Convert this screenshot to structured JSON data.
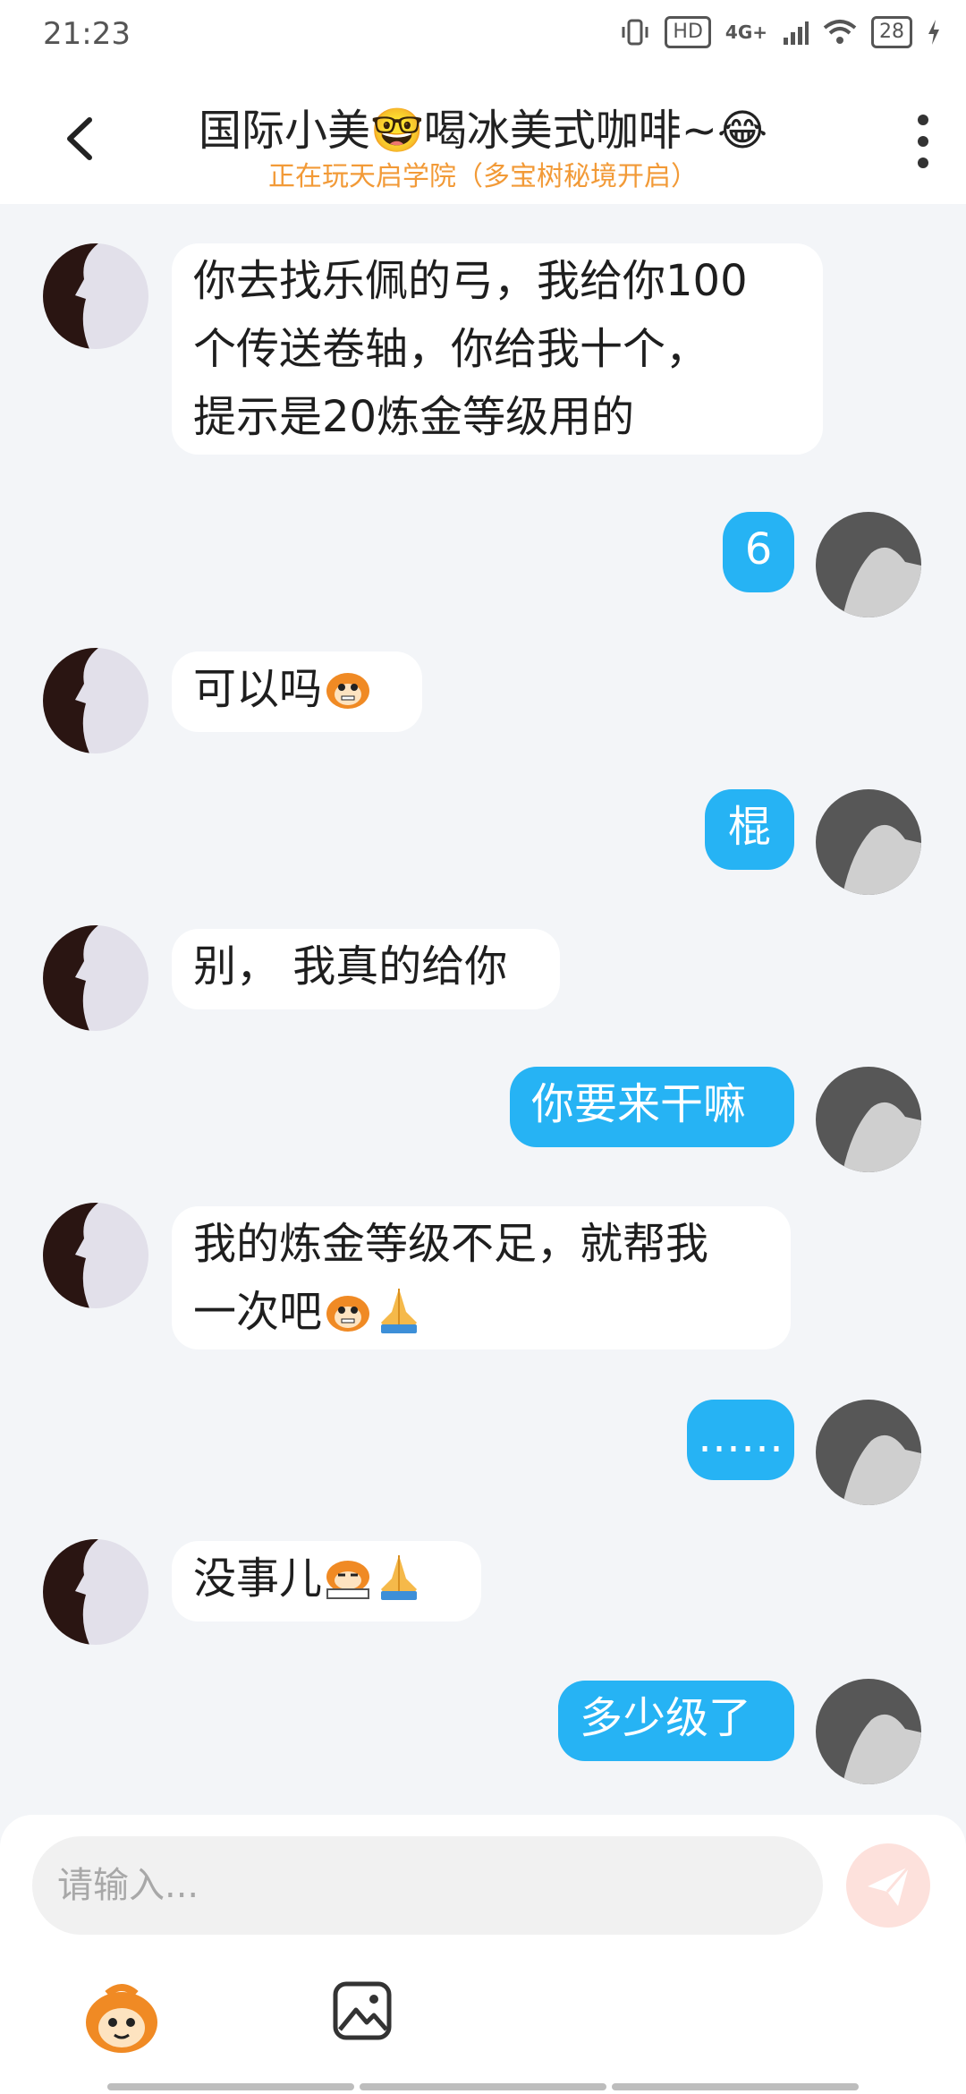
{
  "status_bar": {
    "time": "21:23",
    "hd": "HD",
    "network": "4G+",
    "battery": "28"
  },
  "header": {
    "title": "国际小美🤓喝冰美式咖啡~😂",
    "subtitle": "正在玩天启学院（多宝树秘境开启）"
  },
  "messages": [
    {
      "from": "other",
      "lines": [
        "你去找乐佩的弓，我给你100",
        "个传送卷轴，你给我十个，",
        "提示是20炼金等级用的"
      ]
    },
    {
      "from": "me",
      "text": "6"
    },
    {
      "from": "other",
      "text": "可以吗",
      "emojis": [
        "monkey-face"
      ]
    },
    {
      "from": "me",
      "text": "棍"
    },
    {
      "from": "other",
      "text": "别， 我真的给你"
    },
    {
      "from": "me",
      "text": "你要来干嘛"
    },
    {
      "from": "other",
      "lines": [
        "我的炼金等级不足，就帮我",
        "一次吧"
      ],
      "emojis": [
        "monkey-face",
        "folded-hands"
      ]
    },
    {
      "from": "me",
      "text": "……"
    },
    {
      "from": "other",
      "text": "没事儿",
      "emojis": [
        "monkey-writing",
        "folded-hands"
      ]
    },
    {
      "from": "me",
      "text": "多少级了"
    }
  ],
  "input": {
    "placeholder": "请输入..."
  },
  "colors": {
    "bubble_out": "#26b3f4",
    "bubble_in": "#ffffff",
    "subtitle": "#f29a37",
    "background": "#f3f5f8"
  },
  "icons": {
    "back": "chevron-left-icon",
    "more": "more-vertical-icon",
    "send": "send-icon",
    "emoji": "monkey-emoji-icon",
    "image": "image-icon"
  }
}
